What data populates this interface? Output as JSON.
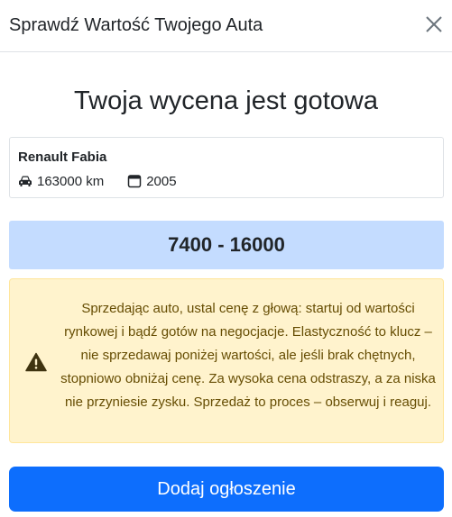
{
  "modal": {
    "title": "Sprawdź Wartość Twojego Auta",
    "close_icon": "close-icon"
  },
  "result": {
    "headline": "Twoja wycena jest gotowa"
  },
  "car": {
    "name": "Renault Fabia",
    "mileage": "163000 km",
    "year": "2005",
    "mileage_icon": "car-icon",
    "year_icon": "calendar-icon"
  },
  "price": {
    "range": "7400 - 16000",
    "background": "#c4dcff"
  },
  "advice": {
    "icon": "warning-icon",
    "text": "Sprzedając auto, ustal cenę z głową: startuj od wartości rynkowej i bądź gotów na negocjacje. Elastyczność to klucz – nie sprzedawaj poniżej wartości, ale jeśli brak chętnych, stopniowo obniżaj cenę. Za wysoka cena odstraszy, a za niska nie przyniesie zysku. Sprzedaż to proces – obserwuj i reaguj.",
    "background": "#fff3cd",
    "text_color": "#664d03"
  },
  "actions": {
    "add_listing_label": "Dodaj ogłoszenie",
    "accent": "#0d6efd"
  }
}
